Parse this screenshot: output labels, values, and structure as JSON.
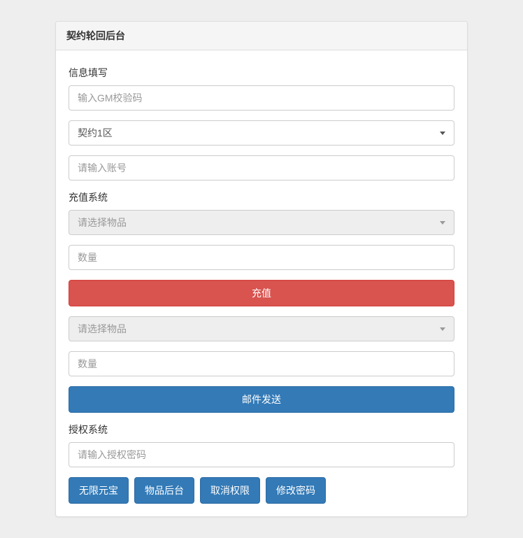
{
  "header": {
    "title": "契约轮回后台"
  },
  "info_section": {
    "label": "信息填写",
    "gm_code_placeholder": "输入GM校验码",
    "server_selected": "契约1区",
    "account_placeholder": "请输入账号"
  },
  "recharge_section": {
    "label": "充值系统",
    "item_select_placeholder": "请选择物品",
    "quantity_placeholder": "数量",
    "recharge_button": "充值",
    "item_select2_placeholder": "请选择物品",
    "quantity2_placeholder": "数量",
    "mail_send_button": "邮件发送"
  },
  "auth_section": {
    "label": "授权系统",
    "auth_password_placeholder": "请输入授权密码"
  },
  "action_buttons": {
    "unlimited_yuanbao": "无限元宝",
    "item_backend": "物品后台",
    "revoke_permission": "取消权限",
    "change_password": "修改密码"
  }
}
